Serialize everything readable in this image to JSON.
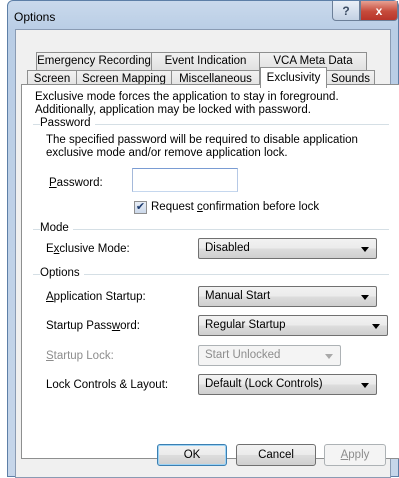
{
  "window": {
    "title": "Options",
    "help_glyph": "?",
    "close_glyph": "x"
  },
  "tabs": {
    "row_top": [
      "Emergency Recording",
      "Event Indication",
      "VCA Meta Data"
    ],
    "row_bottom": [
      "Screen",
      "Screen Mapping",
      "Miscellaneous",
      "Exclusivity",
      "Sounds"
    ],
    "active": "Exclusivity"
  },
  "intro": {
    "line1": "Exclusive mode forces the application to stay in foreground.",
    "line2": "Additionally, application may be locked with password."
  },
  "password_group": {
    "label": "Password",
    "desc1": "The specified password will be required to disable application",
    "desc2": "exclusive mode and/or remove application lock.",
    "field_label_mn": "P",
    "field_label_rest": "assword:",
    "value": "",
    "confirm_checked": true,
    "confirm_pre": "Request ",
    "confirm_mn": "c",
    "confirm_post": "onfirmation before lock"
  },
  "mode_group": {
    "label": "Mode",
    "exclusive_pre": "E",
    "exclusive_mn": "x",
    "exclusive_post": "clusive Mode:",
    "exclusive_value": "Disabled"
  },
  "options_group": {
    "label": "Options",
    "app_startup_mn": "A",
    "app_startup_rest": "pplication Startup:",
    "app_startup_value": "Manual Start",
    "startup_pw_pre": "Startup Pass",
    "startup_pw_mn": "w",
    "startup_pw_post": "ord:",
    "startup_pw_value": "Regular Startup",
    "startup_lock_mn": "S",
    "startup_lock_rest": "tartup Lock:",
    "startup_lock_value": "Start Unlocked",
    "lock_controls_label": "Lock Controls & Layout:",
    "lock_controls_value": "Default (Lock Controls)"
  },
  "footer": {
    "ok": "OK",
    "cancel": "Cancel",
    "apply_mn": "A",
    "apply_rest": "pply"
  }
}
